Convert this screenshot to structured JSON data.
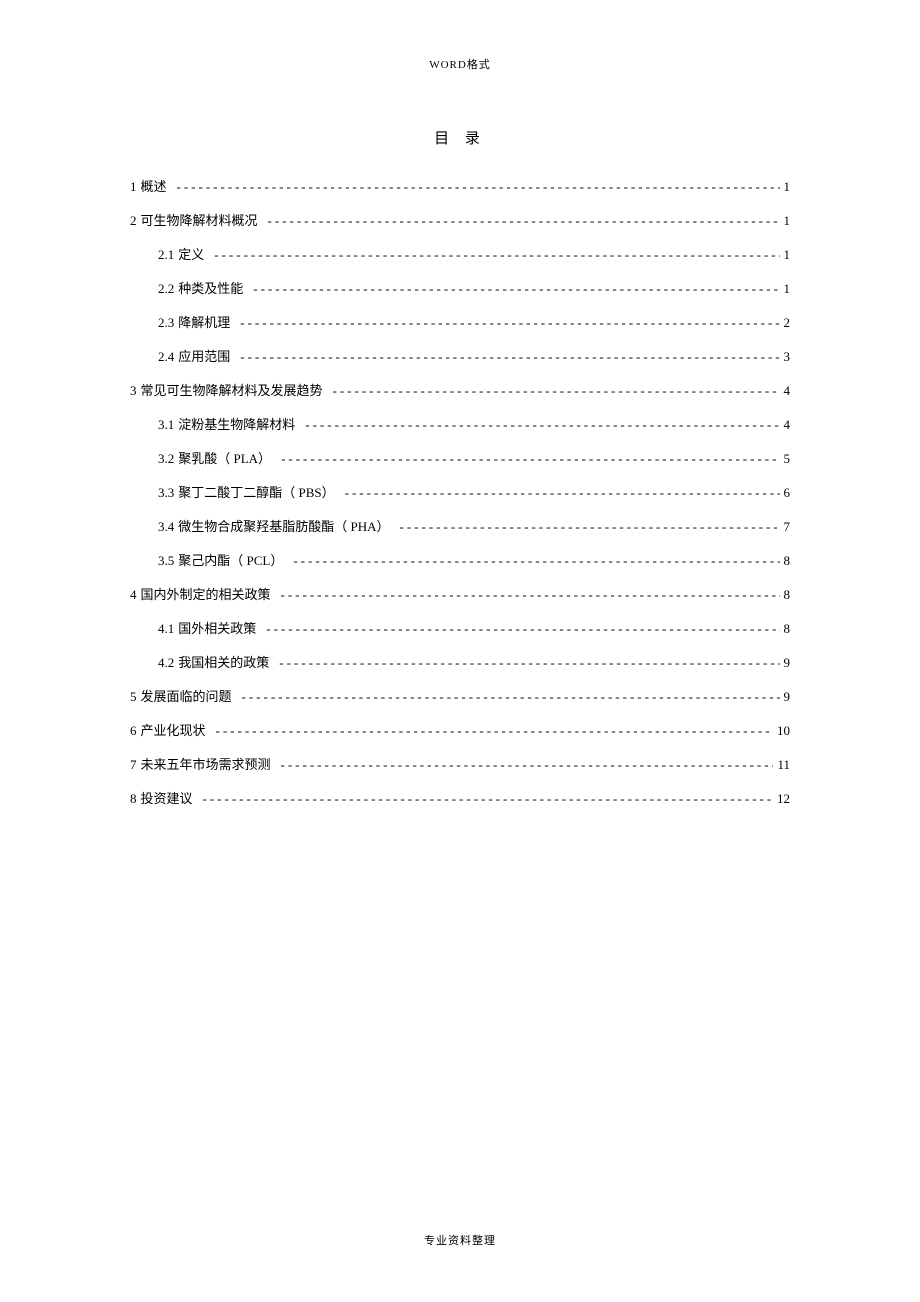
{
  "header": "WORD格式",
  "footer": "专业资料整理",
  "toc_title": "目 录",
  "leader_char_seq": "-------------------------------------------------------------------------------------------------------------------------------------",
  "entries": [
    {
      "level": 1,
      "num": "1",
      "label": "概述",
      "page": "1"
    },
    {
      "level": 1,
      "num": "2",
      "label": "可生物降解材料概况",
      "page": "1"
    },
    {
      "level": 2,
      "num": "2.1",
      "label": "定义",
      "page": "1"
    },
    {
      "level": 2,
      "num": "2.2",
      "label": "种类及性能",
      "page": "1"
    },
    {
      "level": 2,
      "num": "2.3",
      "label": "降解机理",
      "page": "2"
    },
    {
      "level": 2,
      "num": "2.4",
      "label": "应用范围",
      "page": "3"
    },
    {
      "level": 1,
      "num": "3",
      "label": "常见可生物降解材料及发展趋势",
      "page": "4"
    },
    {
      "level": 2,
      "num": "3.1",
      "label": "淀粉基生物降解材料",
      "page": "4"
    },
    {
      "level": 2,
      "num": "3.2",
      "label": "聚乳酸（ PLA）",
      "page": "5"
    },
    {
      "level": 2,
      "num": "3.3",
      "label": "聚丁二酸丁二醇酯（   PBS）",
      "page": "6"
    },
    {
      "level": 2,
      "num": "3.4",
      "label": "微生物合成聚羟基脂肪酸酯（    PHA）",
      "page": "7"
    },
    {
      "level": 2,
      "num": "3.5",
      "label": "聚己内酯（ PCL）",
      "page": "8"
    },
    {
      "level": 1,
      "num": "4",
      "label": "国内外制定的相关政策",
      "page": "8"
    },
    {
      "level": 2,
      "num": "4.1",
      "label": "国外相关政策",
      "page": "8"
    },
    {
      "level": 2,
      "num": "4.2",
      "label": "我国相关的政策",
      "page": "9"
    },
    {
      "level": 1,
      "num": "5",
      "label": "发展面临的问题",
      "page": "9"
    },
    {
      "level": 1,
      "num": "6",
      "label": "产业化现状",
      "page": "10"
    },
    {
      "level": 1,
      "num": "7",
      "label": "未来五年市场需求预测",
      "page": "11"
    },
    {
      "level": 1,
      "num": "8",
      "label": "投资建议",
      "page": "12"
    }
  ]
}
